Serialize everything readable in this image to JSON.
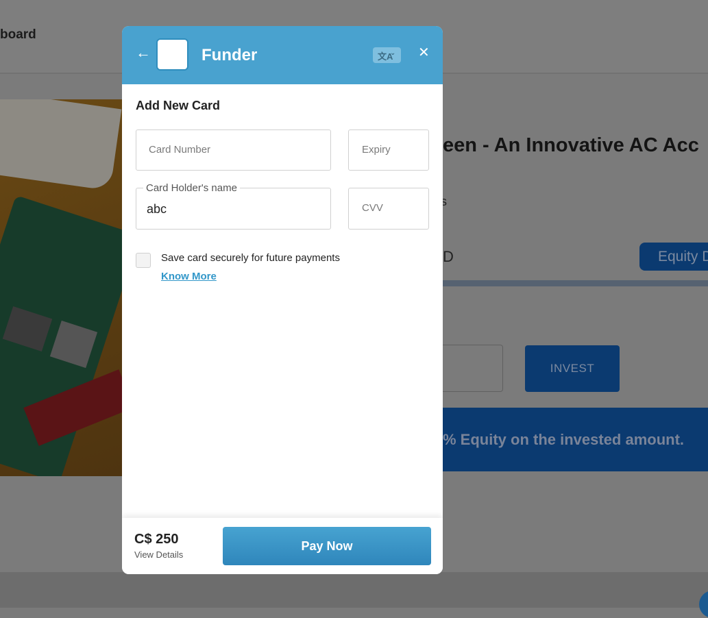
{
  "background": {
    "nav_label": "board",
    "project_title": "een - An Innovative AC Acc",
    "small_text": "s",
    "goal_text": "D",
    "equity_badge": "Equity D",
    "invest_button": "INVEST",
    "banner_text": "% Equity on the invested amount."
  },
  "modal": {
    "brand": "Funder",
    "lang_glyph": "文A",
    "title": "Add New Card",
    "fields": {
      "card_number_placeholder": "Card Number",
      "expiry_placeholder": "Expiry",
      "holder_label": "Card Holder's name",
      "holder_value": "abc",
      "cvv_placeholder": "CVV"
    },
    "save_card_label": "Save card securely for future payments",
    "know_more": "Know More",
    "footer": {
      "amount": "C$ 250",
      "view_details": "View Details",
      "pay_button": "Pay Now"
    }
  },
  "colors": {
    "header": "#49a2cf",
    "pay_button": "#3b95c6",
    "link": "#3297c9"
  }
}
